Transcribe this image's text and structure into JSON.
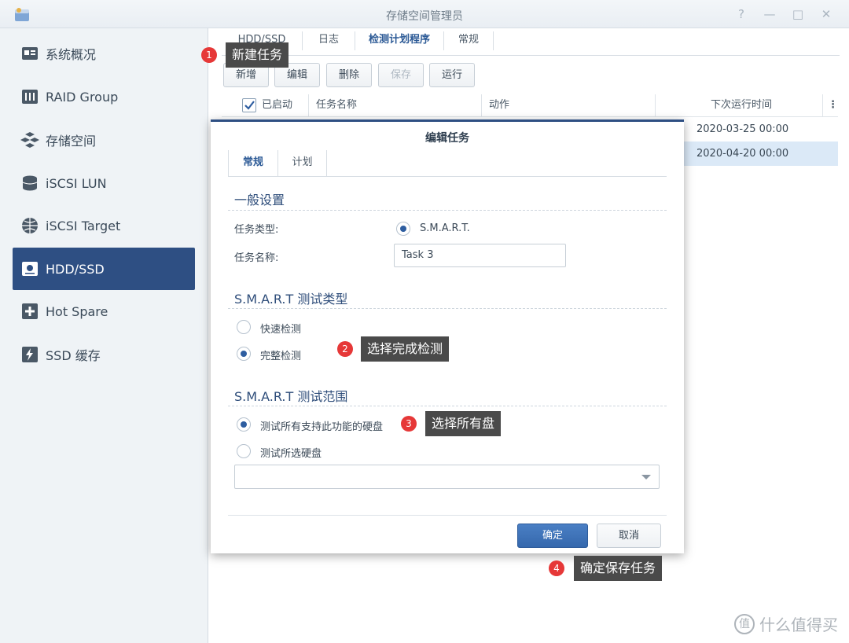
{
  "window": {
    "title": "存储空间管理员",
    "controls": [
      "?",
      "—",
      "□",
      "✕"
    ]
  },
  "sidebar": {
    "items": [
      {
        "label": "系统概况",
        "icon": "overview-icon"
      },
      {
        "label": "RAID Group",
        "icon": "raid-icon"
      },
      {
        "label": "存储空间",
        "icon": "volume-icon"
      },
      {
        "label": "iSCSI LUN",
        "icon": "lun-icon"
      },
      {
        "label": "iSCSI Target",
        "icon": "target-icon"
      },
      {
        "label": "HDD/SSD",
        "icon": "disk-icon",
        "active": true
      },
      {
        "label": "Hot Spare",
        "icon": "hot-spare-icon"
      },
      {
        "label": "SSD 缓存",
        "icon": "ssd-cache-icon"
      }
    ]
  },
  "tabs": [
    "HDD/SSD",
    "日志",
    "检测计划程序",
    "常规"
  ],
  "toolbar": {
    "new": "新增",
    "edit": "编辑",
    "delete": "删除",
    "save": "保存",
    "run": "运行"
  },
  "grid": {
    "headers": {
      "enabled": "已启动",
      "name": "任务名称",
      "action": "动作",
      "next_run": "下次运行时间"
    },
    "rows": [
      {
        "next_run": "2020-03-25 00:00"
      },
      {
        "next_run": "2020-04-20 00:00"
      }
    ]
  },
  "dialog": {
    "title": "编辑任务",
    "tabs": [
      "常规",
      "计划"
    ],
    "general_section": "一般设置",
    "task_type_label": "任务类型:",
    "task_type_value": "S.M.A.R.T.",
    "task_name_label": "任务名称:",
    "task_name_value": "Task 3",
    "test_type_section": "S.M.A.R.T 测试类型",
    "test_type_options": [
      "快速检测",
      "完整检测"
    ],
    "test_scope_section": "S.M.A.R.T 测试范围",
    "test_scope_options": [
      "测试所有支持此功能的硬盘",
      "测试所选硬盘"
    ],
    "ok": "确定",
    "cancel": "取消"
  },
  "annotations": [
    {
      "num": "1",
      "text": "新建任务"
    },
    {
      "num": "2",
      "text": "选择完成检测"
    },
    {
      "num": "3",
      "text": "选择所有盘"
    },
    {
      "num": "4",
      "text": "确定保存任务"
    }
  ],
  "watermark": {
    "badge": "值",
    "text": "什么值得买"
  },
  "colors": {
    "accent": "#2e4f83",
    "annotation": "#e63838"
  }
}
